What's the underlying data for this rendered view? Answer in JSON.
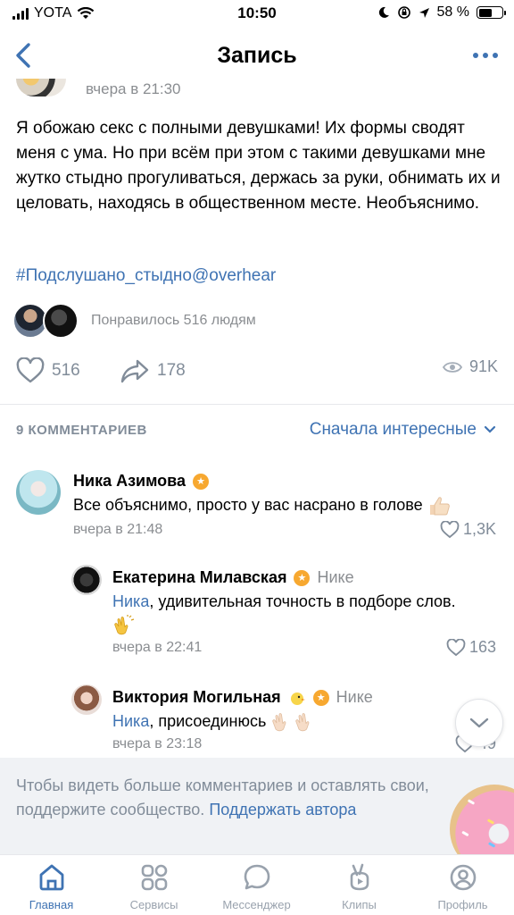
{
  "status_bar": {
    "carrier": "YOTA",
    "time": "10:50",
    "battery": "58 %",
    "battery_level": 0.58
  },
  "navbar": {
    "title": "Запись"
  },
  "post": {
    "date": "вчера в 21:30",
    "text": "Я обожаю секс с полными девушками! Их формы сводят меня с ума. Но при всём при этом с такими девушками мне жутко стыдно прогуливаться, держась за руки, обнимать их и целовать, находясь в общественном месте. Необъяснимо.",
    "hashtag": "#Подслушано_стыдно@overhear",
    "liked_by": "Понравилось 516 людям",
    "likes": "516",
    "shares": "178",
    "views": "91K"
  },
  "comments_header": {
    "count": "9 КОММЕНТАРИЕВ",
    "sort": "Сначала интересные"
  },
  "comments": [
    {
      "author": "Ника Азимова",
      "text": "Все объяснимо, просто у вас насрано в голове",
      "date": "вчера в 21:48",
      "likes": "1,3K"
    },
    {
      "author": "Екатерина Милавская",
      "reply_to": "Нике",
      "mention": "Ника",
      "text": ", удивительная точность в подборе слов.",
      "date": "вчера в 22:41",
      "likes": "163"
    },
    {
      "author": "Виктория Могильная",
      "reply_to": "Нике",
      "mention": "Ника",
      "text": ", присоединюсь",
      "date": "вчера в 23:18",
      "likes": "49"
    }
  ],
  "support": {
    "text": "Чтобы видеть больше комментариев и оставлять свои, поддержите сообщество.",
    "link": "Поддержать автора"
  },
  "tabs": [
    {
      "label": "Главная",
      "icon": "home-icon",
      "active": true
    },
    {
      "label": "Сервисы",
      "icon": "services-icon"
    },
    {
      "label": "Мессенджер",
      "icon": "messenger-icon"
    },
    {
      "label": "Клипы",
      "icon": "clips-icon"
    },
    {
      "label": "Профиль",
      "icon": "profile-icon"
    }
  ],
  "colors": {
    "accent": "#3f73b3",
    "secondary_text": "#818c99",
    "badge": "#f7a830",
    "support_bg": "#f0f2f5"
  }
}
